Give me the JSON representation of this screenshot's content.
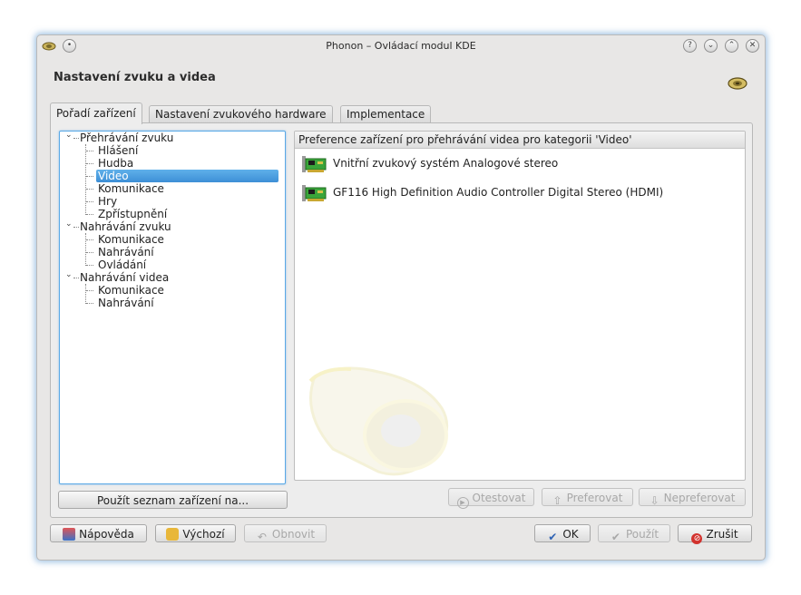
{
  "window": {
    "title": "Phonon – Ovládací modul KDE"
  },
  "header": {
    "title": "Nastavení zvuku a videa"
  },
  "tabs": [
    {
      "label": "Pořadí zařízení",
      "mnemonic": "z"
    },
    {
      "label": "Nastavení zvukového hardware",
      "mnemonic": "h"
    },
    {
      "label": "Implementace",
      "mnemonic": "I"
    }
  ],
  "tree": {
    "groups": [
      {
        "label": "Přehrávání zvuku",
        "children": [
          "Hlášení",
          "Hudba",
          "Video",
          "Komunikace",
          "Hry",
          "Zpřístupnění"
        ]
      },
      {
        "label": "Nahrávání zvuku",
        "children": [
          "Komunikace",
          "Nahrávání",
          "Ovládání"
        ]
      },
      {
        "label": "Nahrávání videa",
        "children": [
          "Komunikace",
          "Nahrávání"
        ]
      }
    ],
    "selected": "Video",
    "expander_glyph": "⌄"
  },
  "device_list": {
    "header": "Preference zařízení pro přehrávání videa pro kategorii 'Video'",
    "items": [
      "Vnitřní zvukový systém Analogové stereo",
      "GF116 High Definition Audio Controller Digital Stereo (HDMI)"
    ]
  },
  "buttons": {
    "apply_list": "Použít seznam zařízení na...",
    "test": "Otestovat",
    "prefer": "Preferovat",
    "defer": "Nepreferovat",
    "help": "Nápověda",
    "defaults": "Výchozí",
    "reset": "Obnovit",
    "ok": "OK",
    "apply": "Použít",
    "cancel": "Zrušit"
  },
  "colors": {
    "selection": "#3d8fd6",
    "focus_border": "#5aa9e6",
    "window_bg": "#e8e7e6"
  }
}
